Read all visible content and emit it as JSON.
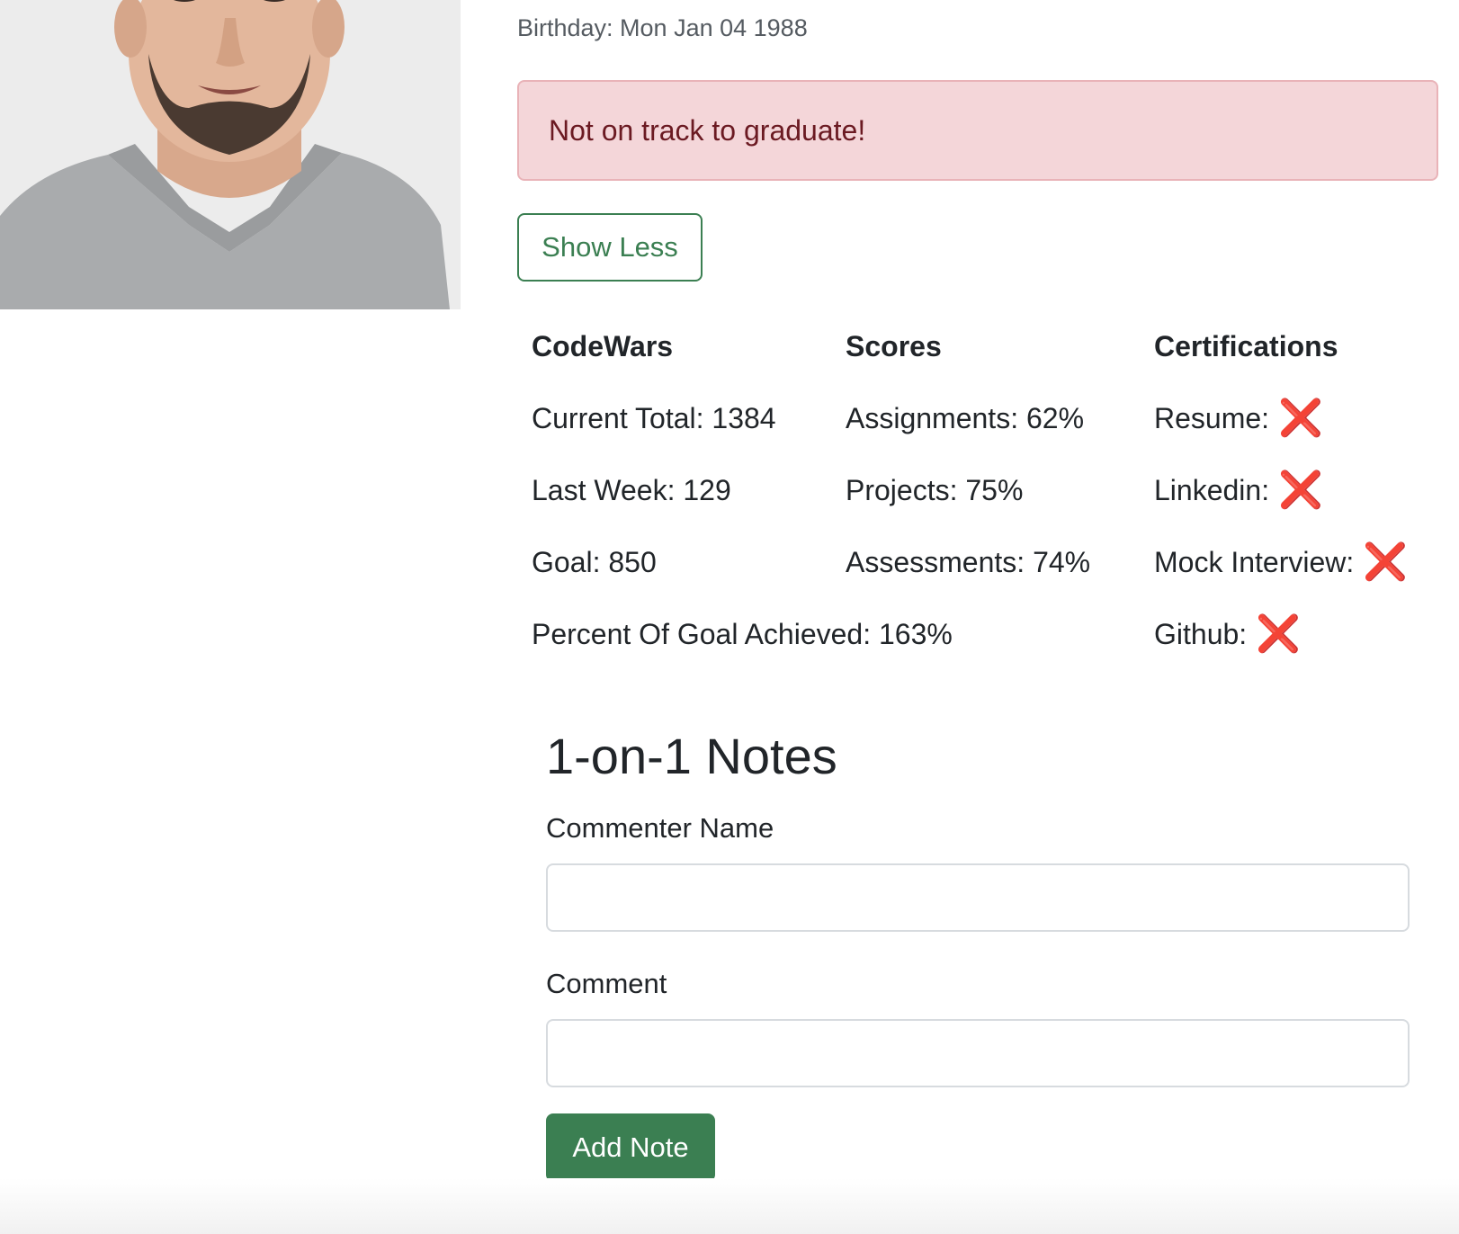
{
  "profile": {
    "birthday": "Birthday: Mon Jan 04 1988",
    "alert": "Not on track to graduate!",
    "toggle_label": "Show Less"
  },
  "stats": {
    "codewars": {
      "heading": "CodeWars",
      "current_total": "Current Total: 1384",
      "last_week": "Last Week: 129",
      "goal": "Goal: 850",
      "percent_goal": "Percent Of Goal Achieved: 163%"
    },
    "scores": {
      "heading": "Scores",
      "assignments": "Assignments: 62%",
      "projects": "Projects: 75%",
      "assessments": "Assessments: 74%"
    },
    "certifications": {
      "heading": "Certifications",
      "items": [
        {
          "label": "Resume:",
          "status": "not-completed"
        },
        {
          "label": "Linkedin:",
          "status": "not-completed"
        },
        {
          "label": "Mock Interview:",
          "status": "not-completed"
        },
        {
          "label": "Github:",
          "status": "not-completed"
        }
      ],
      "status_glyph": "❌"
    }
  },
  "notes": {
    "title": "1-on-1 Notes",
    "commenter_label": "Commenter Name",
    "commenter_value": "",
    "comment_label": "Comment",
    "comment_value": "",
    "submit_label": "Add Note"
  },
  "colors": {
    "accent_green": "#3b7f52",
    "alert_bg": "#f4d6d9",
    "alert_text": "#6b1a22",
    "x_mark": "#e02020"
  }
}
